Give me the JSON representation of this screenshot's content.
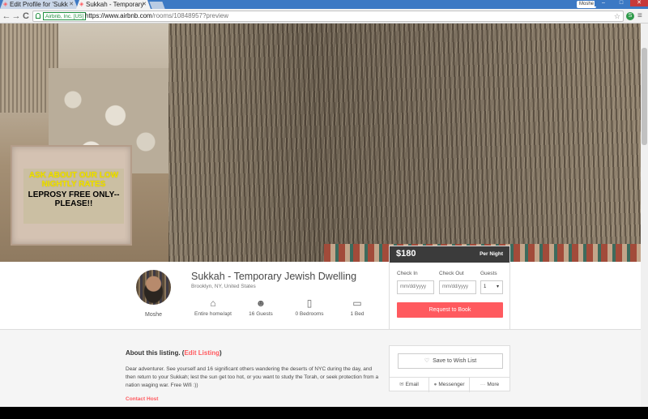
{
  "browser": {
    "tabs": [
      {
        "title": "Edit Profile for 'Sukk",
        "active": false
      },
      {
        "title": "Sukkah - Temporary",
        "active": true
      }
    ],
    "user_badge": "Moshe",
    "window_controls": {
      "minimize": "–",
      "maximize": "□",
      "close": "✕"
    },
    "back_icon": "←",
    "forward_icon": "→",
    "reload_icon": "C",
    "ev_label": "Airbnb, Inc. [US]",
    "url_main": "https://www.airbnb.com",
    "url_path": "/rooms/10848957?preview",
    "star_icon": "☆",
    "extension_icon": "S",
    "menu_icon": "≡"
  },
  "hero": {
    "sign_line1": "ASK ABOUT OUR LOW NIGHTLY RATES",
    "sign_line2": "LEPROSY FREE ONLY-- PLEASE!!"
  },
  "host": {
    "name": "Moshe"
  },
  "listing": {
    "title": "Sukkah - Temporary Jewish Dwelling",
    "location": "Brooklyn, NY, United States",
    "amenities": [
      {
        "icon": "home-icon",
        "glyph": "⌂",
        "label": "Entire home/apt"
      },
      {
        "icon": "guests-icon",
        "glyph": "☻",
        "label": "16 Guests"
      },
      {
        "icon": "door-icon",
        "glyph": "▯",
        "label": "0 Bedrooms"
      },
      {
        "icon": "bed-icon",
        "glyph": "▭",
        "label": "1 Bed"
      }
    ]
  },
  "booking": {
    "price": "$180",
    "per_night": "Per Night",
    "check_in_label": "Check In",
    "check_out_label": "Check Out",
    "guests_label": "Guests",
    "check_in_placeholder": "mm/dd/yyyy",
    "check_out_placeholder": "mm/dd/yyyy",
    "guests_value": "1",
    "guests_caret": "▾",
    "request_button": "Request to Book"
  },
  "about": {
    "heading": "About this listing.",
    "open_paren": "(",
    "edit_link": "Edit Listing",
    "close_paren": ")",
    "description": "Dear adventurer. See yourself and 16 significant others wandering the deserts of NYC during the day, and then return to your Sukkah; lest the sun get too hot, or you want to study the Torah, or seek protection from a nation waging war. Free Wifi :))",
    "contact_host": "Contact Host"
  },
  "share": {
    "wish_list": "Save to Wish List",
    "heart_glyph": "♡",
    "email": "Email",
    "email_glyph": "✉",
    "messenger": "Messenger",
    "messenger_glyph": "●",
    "more": "More",
    "more_glyph": "···"
  },
  "colors": {
    "brand": "#ff5a5f",
    "price_bar": "#3b3b3b",
    "sign_yellow": "#f2e400"
  }
}
